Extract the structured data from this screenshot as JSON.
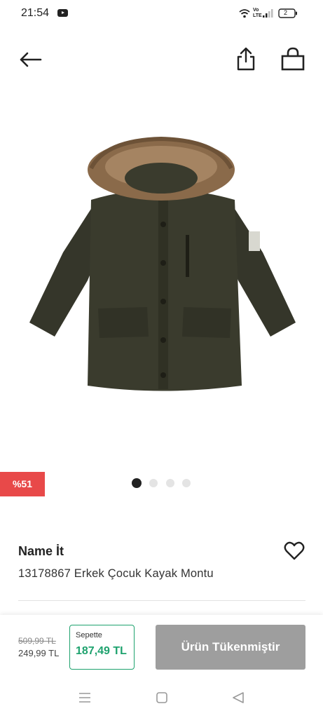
{
  "status": {
    "time": "21:54",
    "network_label": "Vo LTE",
    "battery_level": "2"
  },
  "product": {
    "brand": "Name İt",
    "title": "13178867 Erkek Çocuk Kayak Montu",
    "discount_badge": "%51",
    "image_count": 4,
    "active_image": 1,
    "image_subject": "dark olive hooded winter jacket with fur trim"
  },
  "pricing": {
    "old_price": "509,99 TL",
    "new_price": "249,99 TL",
    "basket_label": "Sepette",
    "basket_price": "187,49 TL"
  },
  "actions": {
    "sold_out_label": "Ürün Tükenmiştir"
  },
  "icons": {
    "back": "arrow-left-icon",
    "share": "share-icon",
    "bag": "shopping-bag-icon",
    "favorite": "heart-icon"
  },
  "colors": {
    "discount_red": "#e84949",
    "basket_green": "#1ea26e",
    "disabled_gray": "#9e9e9e",
    "jacket_olive": "#3a3a2c"
  }
}
